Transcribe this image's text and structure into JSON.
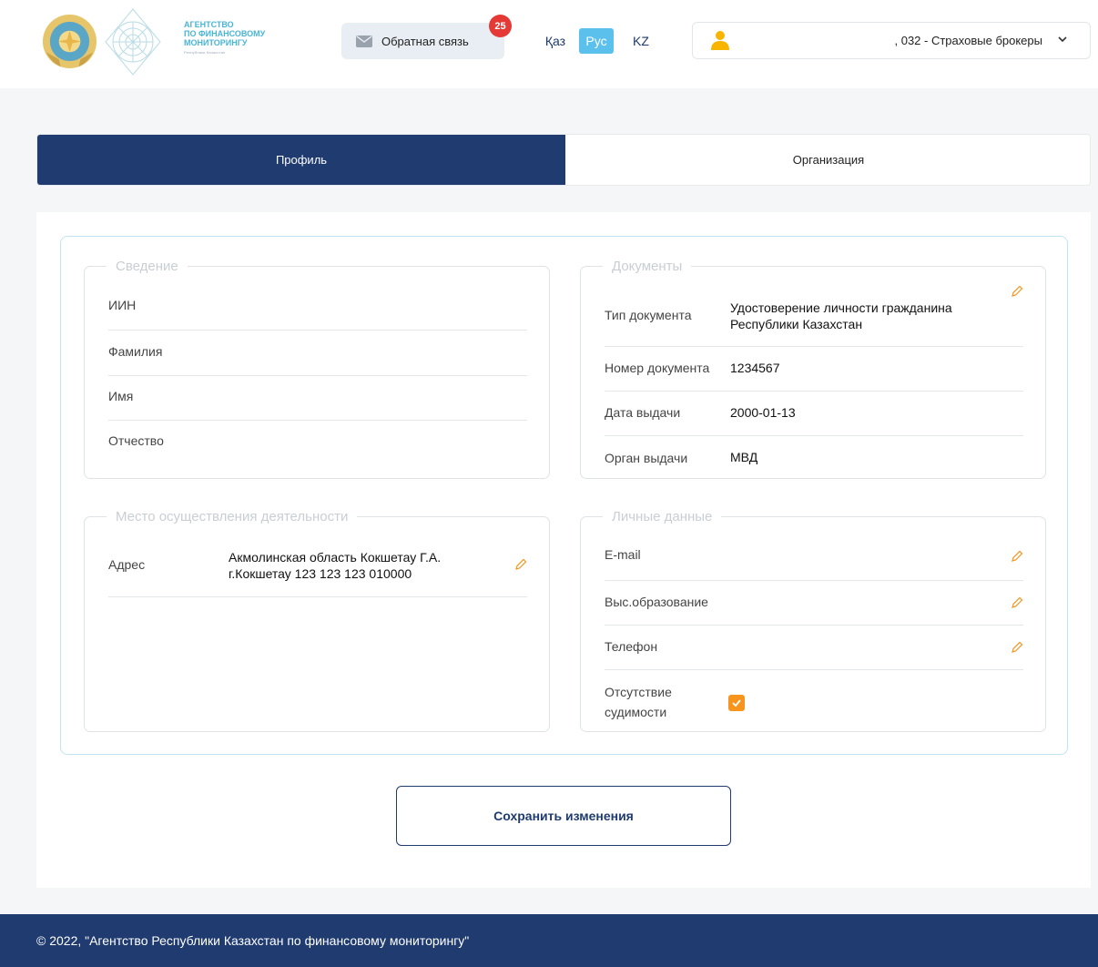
{
  "header": {
    "agency_line1": "Агентство",
    "agency_line2": "по финансовому",
    "agency_line3": "мониторингу",
    "agency_sub": "Республики Казахстан",
    "feedback_label": "Обратная связь",
    "feedback_badge": "25",
    "languages": [
      "Қаз",
      "Рус",
      "KZ"
    ],
    "active_language": "Рус",
    "user_label": ", 032 - Страховые брокеры"
  },
  "tabs": {
    "profile": "Профиль",
    "organization": "Организация"
  },
  "info": {
    "legend": "Сведение",
    "fields": [
      "ИИН",
      "Фамилия",
      "Имя",
      "Отчество"
    ]
  },
  "documents": {
    "legend": "Документы",
    "type_label": "Тип документа",
    "type_value_line1": "Удостоверение личности гражданина",
    "type_value_line2": "Республики Казахстан",
    "number_label": "Номер документа",
    "number_value": "1234567",
    "date_label": "Дата выдачи",
    "date_value": "2000-01-13",
    "issuer_label": "Орган выдачи",
    "issuer_value": "МВД"
  },
  "activity": {
    "legend": "Место осуществления деятельности",
    "address_label": "Адрес",
    "address_line1": "Акмолинская область Кокшетау Г.А.",
    "address_line2": "г.Кокшетау 123 123 123 010000"
  },
  "personal": {
    "legend": "Личные данные",
    "email_label": "E-mail",
    "education_label": "Выс.образование",
    "phone_label": "Телефон",
    "no_record_line1": "Отсутствие",
    "no_record_line2": "судимости",
    "no_record_checked": true
  },
  "actions": {
    "save_label": "Сохранить изменения"
  },
  "footer": {
    "text": "© 2022, \"Агентство Республики Казахстан по финансовому мониторингу\""
  },
  "colors": {
    "primary": "#1f3b70",
    "accent_lang": "#5bc0ec",
    "badge": "#e53935",
    "check": "#f7941d",
    "pencil": "#f7941d"
  }
}
